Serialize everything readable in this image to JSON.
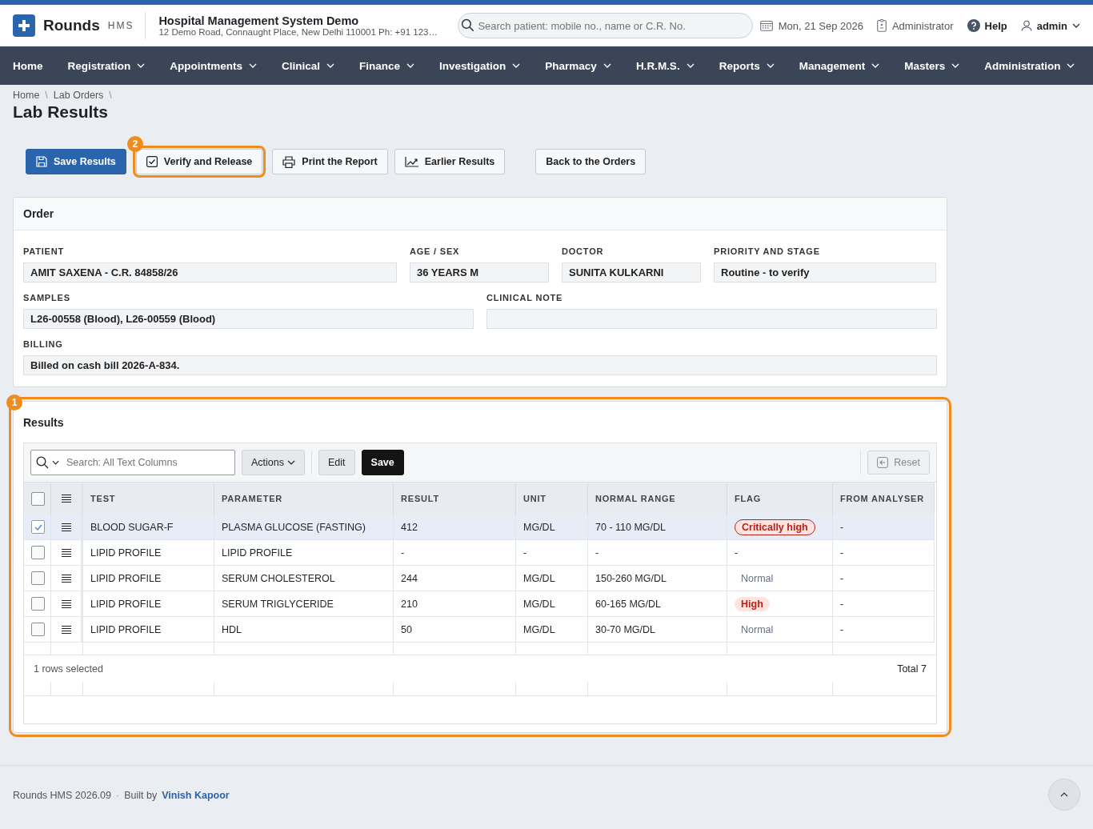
{
  "header": {
    "brand": "Rounds",
    "brand_suffix": "HMS",
    "org_name": "Hospital Management System Demo",
    "org_address": "12 Demo Road, Connaught Place, New Delhi 110001 Ph: +91 123…",
    "search": {
      "placeholder": "Search patient: mobile no., name or C.R. No."
    },
    "date": "Mon, 21 Sep 2026",
    "role": "Administrator",
    "help": "Help",
    "user": "admin"
  },
  "nav": [
    {
      "label": "Home",
      "has_menu": false
    },
    {
      "label": "Registration",
      "has_menu": true
    },
    {
      "label": "Appointments",
      "has_menu": true
    },
    {
      "label": "Clinical",
      "has_menu": true
    },
    {
      "label": "Finance",
      "has_menu": true
    },
    {
      "label": "Investigation",
      "has_menu": true
    },
    {
      "label": "Pharmacy",
      "has_menu": true
    },
    {
      "label": "H.R.M.S.",
      "has_menu": true
    },
    {
      "label": "Reports",
      "has_menu": true
    },
    {
      "label": "Management",
      "has_menu": true
    },
    {
      "label": "Masters",
      "has_menu": true
    },
    {
      "label": "Administration",
      "has_menu": true
    }
  ],
  "breadcrumb": [
    "Home",
    "Lab Orders"
  ],
  "breadcrumb_separator": "\\",
  "page_title": "Lab Results",
  "actions": [
    {
      "label": "Save Results",
      "kind": "save"
    },
    {
      "label": "Verify and Release",
      "kind": "verify",
      "callout": "2"
    },
    {
      "label": "Print the Report",
      "kind": "print"
    },
    {
      "label": "Earlier Results",
      "kind": "chart"
    },
    {
      "label": "Back to the Orders",
      "kind": "back"
    }
  ],
  "order": {
    "title": "Order",
    "rows": [
      [
        {
          "label": "PATIENT",
          "value": "AMIT SAXENA - C.R. 84858/26"
        },
        {
          "label": "AGE / SEX",
          "value": "36 YEARS M"
        },
        {
          "label": "DOCTOR",
          "value": "SUNITA KULKARNI"
        },
        {
          "label": "PRIORITY AND STAGE",
          "value": "Routine - to verify"
        }
      ],
      [
        {
          "label": "SAMPLES",
          "value": "L26-00558 (Blood), L26-00559 (Blood)"
        },
        {
          "label": "CLINICAL NOTE"
        }
      ],
      [
        {
          "label": "BILLING",
          "value": "Billed on cash bill 2026-A-834."
        }
      ]
    ]
  },
  "results": {
    "title": "Results",
    "callout": "1",
    "search": {
      "placeholder": "Search: All Text Columns"
    },
    "toolbar": [
      {
        "label": "Actions",
        "kind": "menu"
      },
      {
        "label": "Edit",
        "kind": "plain"
      },
      {
        "label": "Save",
        "kind": "dark"
      },
      {
        "label": "Reset",
        "kind": "reset"
      }
    ],
    "all_checked": false,
    "columns": [
      "TEST",
      "PARAMETER",
      "RESULT",
      "UNIT",
      "NORMAL RANGE",
      "FLAG",
      "FROM ANALYSER"
    ],
    "rows": [
      {
        "selected": true,
        "test": "BLOOD SUGAR-F",
        "parameter": "PLASMA GLUCOSE (FASTING)",
        "result": "412",
        "unit": "MG/DL",
        "range": "70 - 110 MG/DL",
        "flag": {
          "text": "Critically high",
          "kind": "critical"
        },
        "analyser": "-"
      },
      {
        "selected": false,
        "test": "LIPID PROFILE",
        "parameter": "LIPID PROFILE",
        "result": "-",
        "unit": "-",
        "range": "-",
        "flag": {
          "text": "-",
          "kind": "none"
        },
        "analyser": "-"
      },
      {
        "selected": false,
        "test": "LIPID PROFILE",
        "parameter": "SERUM CHOLESTEROL",
        "result": "244",
        "unit": "MG/DL",
        "range": "150-260 MG/DL",
        "flag": {
          "text": "Normal",
          "kind": "normal"
        },
        "analyser": "-"
      },
      {
        "selected": false,
        "test": "LIPID PROFILE",
        "parameter": "SERUM TRIGLYCERIDE",
        "result": "210",
        "unit": "MG/DL",
        "range": "60-165 MG/DL",
        "flag": {
          "text": "High",
          "kind": "high"
        },
        "analyser": "-"
      },
      {
        "selected": false,
        "test": "LIPID PROFILE",
        "parameter": "HDL",
        "result": "50",
        "unit": "MG/DL",
        "range": "30-70 MG/DL",
        "flag": {
          "text": "Normal",
          "kind": "normal"
        },
        "analyser": "-"
      }
    ],
    "selection_summary": "1 rows selected",
    "total": "Total 7"
  },
  "footer": {
    "version": "Rounds HMS 2026.09",
    "separator": "·",
    "built_by": "Built by",
    "author": "Vinish Kapoor"
  }
}
